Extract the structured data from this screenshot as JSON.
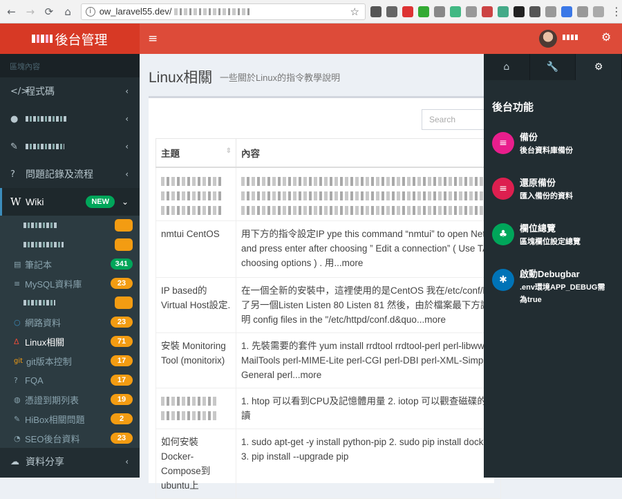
{
  "browser": {
    "url": "ow_laravel55.dev/",
    "info_icon": "i",
    "back_icon": "←",
    "forward_icon": "→",
    "reload_icon": "⟳",
    "home_icon": "⌂",
    "star_icon": "☆",
    "menu_icon": "⋮",
    "extension_colors": [
      "#555555",
      "#666666",
      "#d33",
      "#3a3",
      "#888888",
      "#41b883",
      "#999999",
      "#c44",
      "#4a8",
      "#222222",
      "#555555",
      "#999999",
      "#3b78e7",
      "#999999",
      "#aaaaaa"
    ]
  },
  "header": {
    "logo_text": "後台管理",
    "hamburger_icon": "≡",
    "settings_icon": "⚙"
  },
  "sidebar": {
    "section_header": "區塊內容",
    "items": [
      {
        "icon": "</>",
        "label": "程式碼",
        "chevron": "‹"
      },
      {
        "icon": "●",
        "label": "",
        "chevron": "‹"
      },
      {
        "icon": "✎",
        "label": "",
        "chevron": "‹"
      },
      {
        "icon": "?",
        "label": "問題記錄及流程",
        "chevron": "‹"
      },
      {
        "icon": "W",
        "label": "Wiki",
        "badge": "NEW",
        "chevron": "⌄"
      }
    ],
    "sub_items": [
      {
        "icon": "",
        "label": "",
        "badge": ""
      },
      {
        "icon": "",
        "label": "",
        "badge": ""
      },
      {
        "icon": "▤",
        "label": "筆記本",
        "badge": "341",
        "badge_color": "green"
      },
      {
        "icon": "≡",
        "label": "MySQL資料庫",
        "badge": "23",
        "badge_color": "orange"
      },
      {
        "icon": "",
        "label": "",
        "badge": ""
      },
      {
        "icon": "○",
        "label": "網路資料",
        "badge": "23",
        "badge_color": "orange"
      },
      {
        "icon": "Δ",
        "label": "Linux相關",
        "badge": "71",
        "badge_color": "orange"
      },
      {
        "icon": "git",
        "label": "git版本控制",
        "badge": "17",
        "badge_color": "orange"
      },
      {
        "icon": "?",
        "label": "FQA",
        "badge": "17",
        "badge_color": "orange"
      },
      {
        "icon": "◍",
        "label": "憑證到期列表",
        "badge": "19",
        "badge_color": "orange"
      },
      {
        "icon": "✎",
        "label": "HiBox相關問題",
        "badge": "2",
        "badge_color": "orange"
      },
      {
        "icon": "◔",
        "label": "SEO後台資料",
        "badge": "23",
        "badge_color": "orange"
      }
    ],
    "bottom_item": {
      "icon": "☁",
      "label": "資料分享",
      "chevron": "‹"
    }
  },
  "content": {
    "title": "Linux相關",
    "subtitle": "一些關於Linux的指令教學說明",
    "search_placeholder": "Search",
    "table": {
      "columns": [
        "主題",
        "內容"
      ],
      "sort_icon": "⇕",
      "rows": [
        {
          "topic": "",
          "content": ""
        },
        {
          "topic": "nmtui CentOS",
          "content": "用下方的指令設定IP ype this command “nmtui” to open Netw and press enter after choosing ” Edit a connection” ( Use TA choosing options ) . 用...more"
        },
        {
          "topic": "IP based的 Virtual Host設定.",
          "content": "在一個全新的安裝中，這裡使用的是CentOS 我在/etc/conf/ht 了另一個Listen Listen 80 Listen 81 然後，由於檔案最下方說明 config files in the \"/etc/httpd/conf.d&quo...more"
        },
        {
          "topic": "安裝 Monitoring Tool (monitorix)",
          "content": "1. 先裝需要的套件 yum install rrdtool rrdtool-perl perl-libwww MailTools perl-MIME-Lite perl-CGI perl-DBI perl-XML-Simple General perl...more"
        },
        {
          "topic": "",
          "content": "1. htop 可以看到CPU及記憶體用量 2. iotop 可以觀查磁碟的讀"
        },
        {
          "topic": "如何安裝Docker-Compose到ubuntu上",
          "content": "1. sudo apt-get -y install python-pip 2. sudo pip install docke 3. pip install --upgrade pip"
        }
      ]
    }
  },
  "control_sidebar": {
    "tabs": [
      {
        "icon": "⌂",
        "name": "home"
      },
      {
        "icon": "🔧",
        "name": "wrench"
      },
      {
        "icon": "⚙",
        "name": "gears"
      }
    ],
    "heading": "後台功能",
    "items": [
      {
        "icon": "≡",
        "title": "備份",
        "desc": "後台資料庫備份",
        "color": "#e91e8c"
      },
      {
        "icon": "≡",
        "title": "還原備份",
        "desc": "匯入備份的資料",
        "color": "#dd1f4f"
      },
      {
        "icon": "♣",
        "title": "欄位總覽",
        "desc": "區塊欄位設定總覽",
        "color": "#00a65a"
      },
      {
        "icon": "✱",
        "title": "啟動Debugbar",
        "desc": ".env環境APP_DEBUG需為true",
        "color": "#0073b7"
      }
    ]
  }
}
